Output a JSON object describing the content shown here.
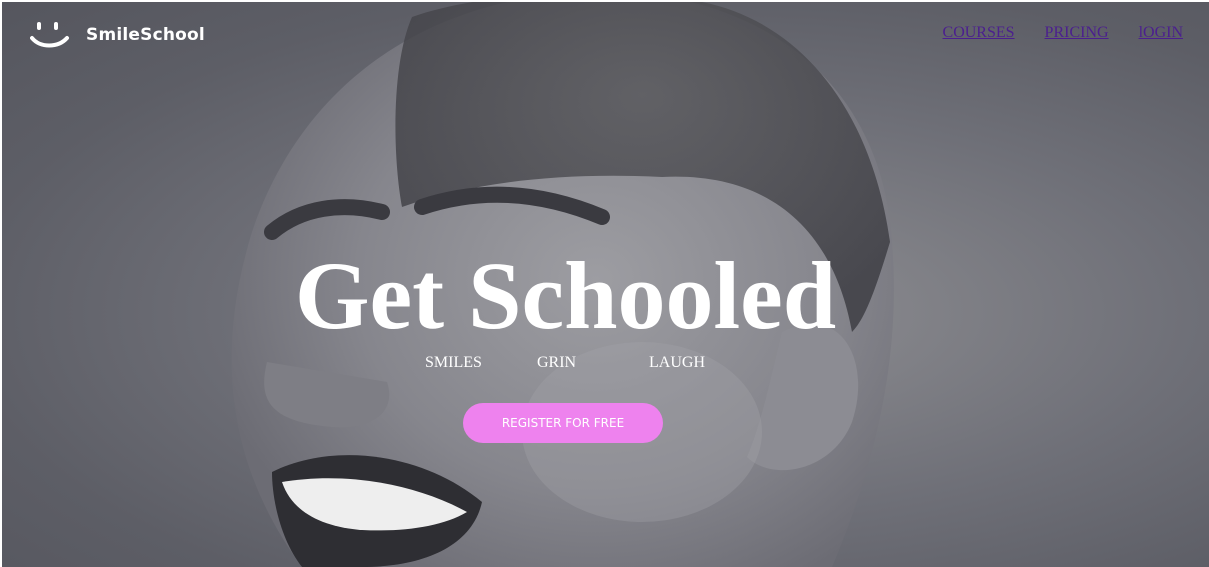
{
  "brand": {
    "name": "SmileSchool",
    "logo_icon": "smiley-face-icon"
  },
  "nav": {
    "items": [
      {
        "label": "COURSES"
      },
      {
        "label": "PRICING"
      },
      {
        "label": "lOGIN"
      }
    ],
    "link_color": "#4b1f8e"
  },
  "hero": {
    "background_image": "smiling-woman-grayscale-photo",
    "headline": "Get Schooled",
    "tags": [
      "SMILES",
      "GRIN",
      "LAUGH"
    ],
    "cta_label": "REGISTER FOR FREE",
    "cta_color": "#ee82ee"
  }
}
